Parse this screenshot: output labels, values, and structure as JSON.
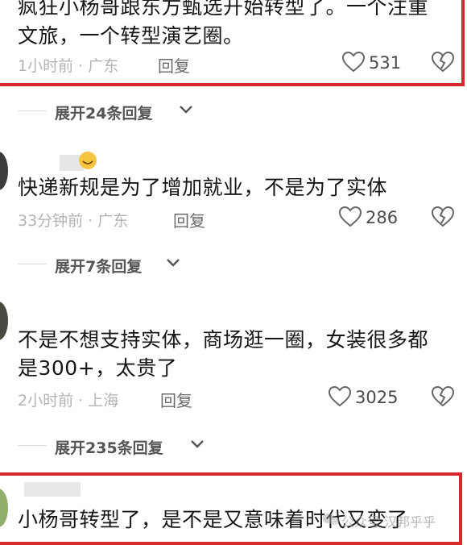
{
  "comments": [
    {
      "lines": [
        "疯狂小杨哥跟东方甄选开始转型了。一个注重",
        "文旅，一个转型演艺圈。"
      ],
      "meta": "1小时前 · 广东",
      "reply_label": "回复",
      "likes": "531",
      "expand_label": "展开24条回复"
    },
    {
      "lines": [
        "快递新规是为了增加就业，不是为了实体"
      ],
      "meta": "33分钟前 · 广东",
      "reply_label": "回复",
      "likes": "286",
      "expand_label": "展开7条回复"
    },
    {
      "lines": [
        "不是不想支持实体，商场逛一圈，女装很多都",
        "是300+，太贵了"
      ],
      "meta": "2小时前 · 上海",
      "reply_label": "回复",
      "likes": "3025",
      "expand_label": "展开235条回复"
    },
    {
      "lines": [
        "小杨哥转型了，是不是又意味着时代又变了"
      ]
    }
  ],
  "watermark": "公众号·汉邦乎乎",
  "colors": {
    "highlight": "#d42a2a"
  }
}
